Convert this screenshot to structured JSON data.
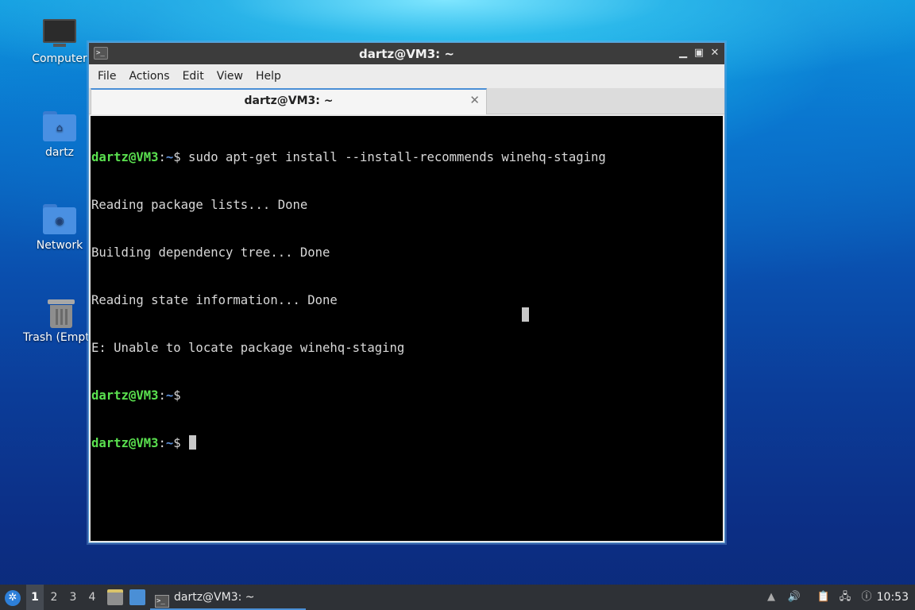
{
  "desktop": {
    "icons": [
      {
        "label": "Computer"
      },
      {
        "label": "dartz"
      },
      {
        "label": "Network"
      },
      {
        "label": "Trash (Empt"
      }
    ]
  },
  "window": {
    "title": "dartz@VM3: ~",
    "controls": {
      "minimize": "▁",
      "maximize": "▣",
      "close": "✕"
    },
    "menu": [
      "File",
      "Actions",
      "Edit",
      "View",
      "Help"
    ],
    "tab": {
      "label": "dartz@VM3: ~",
      "close": "✕"
    }
  },
  "terminal": {
    "lines": [
      {
        "type": "prompt",
        "user": "dartz@VM3",
        "colon": ":",
        "path": "~",
        "sym": "$",
        "cmd": " sudo apt-get install --install-recommends winehq-staging"
      },
      {
        "type": "out",
        "text": "Reading package lists... Done"
      },
      {
        "type": "out",
        "text": "Building dependency tree... Done"
      },
      {
        "type": "out",
        "text": "Reading state information... Done"
      },
      {
        "type": "out",
        "text": "E: Unable to locate package winehq-staging"
      },
      {
        "type": "prompt",
        "user": "dartz@VM3",
        "colon": ":",
        "path": "~",
        "sym": "$",
        "cmd": ""
      },
      {
        "type": "prompt",
        "user": "dartz@VM3",
        "colon": ":",
        "path": "~",
        "sym": "$",
        "cmd": " "
      }
    ]
  },
  "taskbar": {
    "workspaces": [
      "1",
      "2",
      "3",
      "4"
    ],
    "task_label": "dartz@VM3: ~",
    "clock": "10:53"
  },
  "colors": {
    "prompt_user": "#5ae04f",
    "prompt_path": "#5d8fd6",
    "accent": "#4a8fd6"
  }
}
